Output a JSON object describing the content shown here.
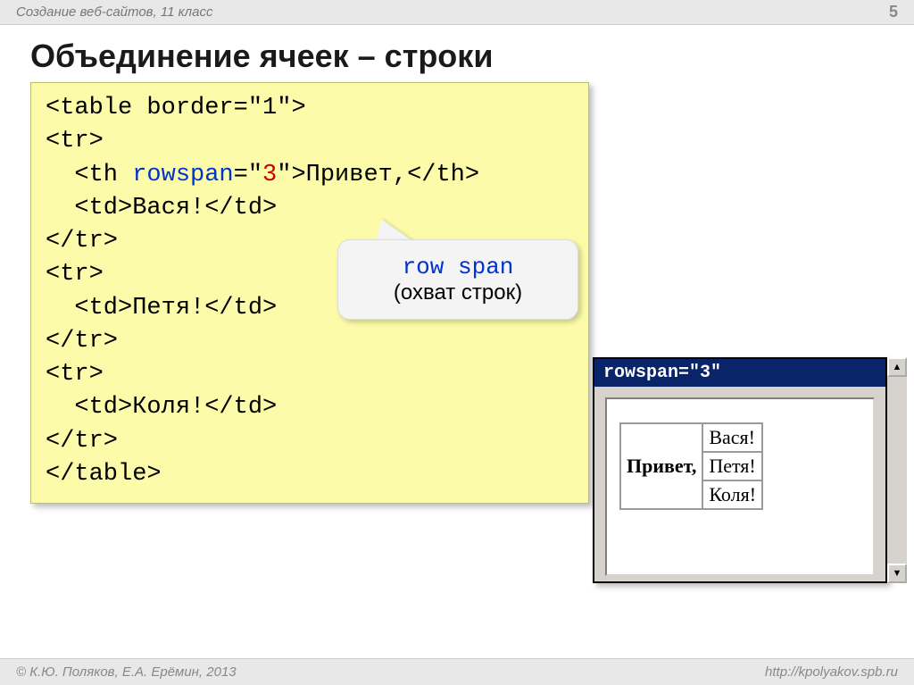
{
  "header": {
    "course": "Создание веб-сайтов, 11 класс",
    "page": "5"
  },
  "title": "Объединение ячеек – строки",
  "code": {
    "l1a": "<table border=\"1\">",
    "l2": "<tr>",
    "l3a": "  <th ",
    "l3_attr": "rowspan",
    "l3b": "=\"",
    "l3_val": "3",
    "l3c": "\">Привет,</th>",
    "l4": "  <td>Вася!</td>",
    "l5": "</tr>",
    "l6": "<tr>",
    "l7": "  <td>Петя!</td>",
    "l8": "</tr>",
    "l9": "<tr>",
    "l10": "  <td>Коля!</td>",
    "l11": "</tr>",
    "l12": "</table>"
  },
  "callout": {
    "line1": "row span",
    "line2": "(охват строк)"
  },
  "browser": {
    "title": "rowspan=\"3\"",
    "th": "Привет,",
    "td1": "Вася!",
    "td2": "Петя!",
    "td3": "Коля!"
  },
  "footer": {
    "authors": "© К.Ю. Поляков, Е.А. Ерёмин, 2013",
    "url": "http://kpolyakov.spb.ru"
  }
}
